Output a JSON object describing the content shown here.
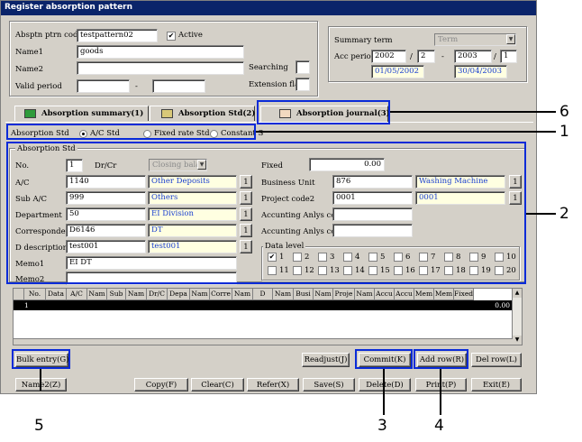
{
  "window": {
    "title": "Register absorption pattern"
  },
  "header": {
    "ptn_code_label": "Absptn ptrn code",
    "ptn_code_value": "testpattern02",
    "active_label": "Active",
    "active_checked": true,
    "name1_label": "Name1",
    "name1_value": "goods",
    "name2_label": "Name2",
    "name2_value": "",
    "valid_label": "Valid period",
    "valid_from": "",
    "valid_sep": "-",
    "valid_to": "",
    "searching_label": "Searching",
    "searching_value": "",
    "extension_label": "Extension flag",
    "extension_value": ""
  },
  "summary": {
    "term_label": "Summary term",
    "term_value": "Term",
    "acc_period_label": "Acc period",
    "from_year": "2002",
    "from_slash": "/",
    "from_month": "2",
    "sep": "-",
    "to_year": "2003",
    "to_slash": "/",
    "to_month": "1",
    "from_date": "01/05/2002",
    "to_date": "30/04/2003"
  },
  "tabs": [
    {
      "label": "Absorption summary(1)"
    },
    {
      "label": "Absorption Std(2)"
    },
    {
      "label": "Absorption journal(3)"
    }
  ],
  "std_options": {
    "label": "Absorption Std",
    "options": [
      "A/C Std",
      "Fixed rate Std",
      "Constant S"
    ],
    "selected": 0
  },
  "group_title": "Absorption Std",
  "form": {
    "no_label": "No.",
    "no_value": "1",
    "drcr_label": "Dr/Cr",
    "drcr_value": "Closing balance",
    "ac_label": "A/C",
    "ac_code": "1140",
    "ac_name": "Other Deposits",
    "subac_label": "Sub A/C",
    "subac_code": "999",
    "subac_name": "Others",
    "dept_label": "Department",
    "dept_code": "50",
    "dept_name": "EI Division",
    "corr_label": "Correspondent",
    "corr_code": "D6146",
    "corr_name": "DT",
    "desc_label": "D description",
    "desc_code": "test001",
    "desc_name": "test001",
    "memo1_label": "Memo1",
    "memo1_value": "EI DT",
    "memo2_label": "Memo2",
    "memo2_value": "",
    "fixed_label": "Fixed",
    "fixed_value": "0.00",
    "bu_label": "Business Unit",
    "bu_code": "876",
    "bu_name": "Washing Machine",
    "proj_label": "Project code2",
    "proj_code": "0001",
    "proj_name": "0001",
    "anlys1_label": "Accunting Anlys code1",
    "anlys1_value": "",
    "anlys2_label": "Accunting Anlys code2",
    "anlys2_value": "",
    "lookup_label": "1"
  },
  "data_level": {
    "label": "Data level",
    "items": [
      "1",
      "2",
      "3",
      "4",
      "5",
      "6",
      "7",
      "8",
      "9",
      "10",
      "11",
      "12",
      "13",
      "14",
      "15",
      "16",
      "17",
      "18",
      "19",
      "20"
    ],
    "checked": [
      "1"
    ]
  },
  "grid": {
    "columns": [
      "No.",
      "Data",
      "A/C",
      "Nam",
      "Sub",
      "Nam",
      "Dr/C",
      "Depa",
      "Nam",
      "Corre",
      "Nam",
      "D",
      "Nam",
      "Busi",
      "Nam",
      "Proje",
      "Nam",
      "Accu",
      "Accu",
      "Mem",
      "Mem",
      "Fixed"
    ],
    "rows": [
      {
        "no": "1",
        "fixed": "0.00"
      }
    ]
  },
  "row_buttons": {
    "bulk": "Bulk entry(G)",
    "readjust": "Readjust(J)",
    "commit": "Commit(K)",
    "add_row": "Add row(R)",
    "del_row": "Del row(L)"
  },
  "bottom_buttons": {
    "name2": "Name2(Z)",
    "copy": "Copy(F)",
    "clear": "Clear(C)",
    "refer": "Refer(X)",
    "save": "Save(S)",
    "delete": "Delete(D)",
    "print": "Print(P)",
    "exit": "Exit(E)"
  },
  "callouts": {
    "c1": "1",
    "c2": "2",
    "c3": "3",
    "c4": "4",
    "c5": "5",
    "c6": "6"
  },
  "colors": {
    "highlight": "#0a2bd8",
    "title_bar": "#0a246a",
    "selected_row": "#000000",
    "lookup_fill": "#ffffe1"
  }
}
